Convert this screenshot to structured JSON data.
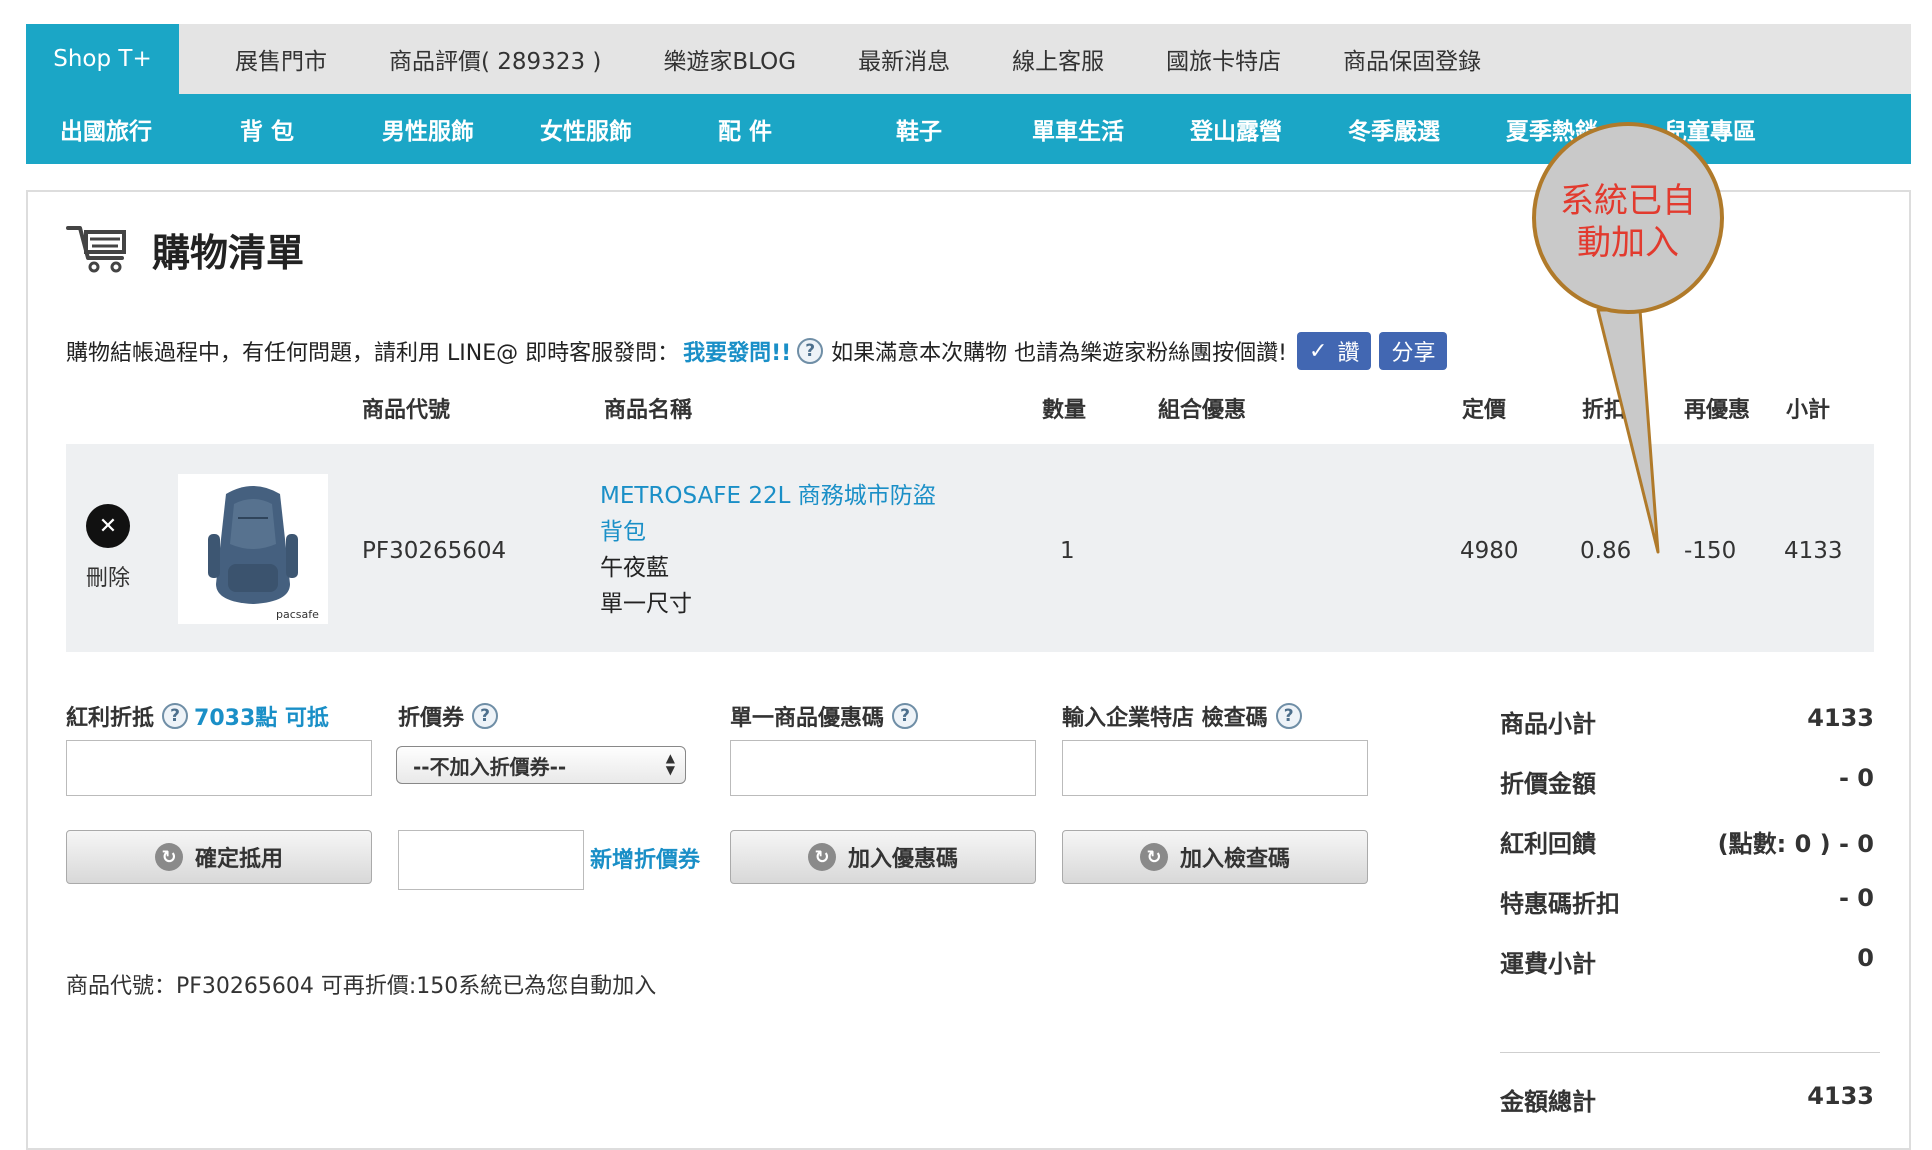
{
  "topnav": {
    "items": [
      "Shop T+",
      "展售門市",
      "商品評價( 289323 )",
      "樂遊家BLOG",
      "最新消息",
      "線上客服",
      "國旅卡特店",
      "商品保固登錄"
    ]
  },
  "subnav": {
    "items": [
      "出國旅行",
      "背 包",
      "男性服飾",
      "女性服飾",
      "配 件",
      "鞋子",
      "單車生活",
      "登山露營",
      "冬季嚴選",
      "夏季熱銷",
      "兒童專區"
    ]
  },
  "page": {
    "title": "購物清單",
    "help_text": "購物結帳過程中，有任何問題，請利用 LINE@ 即時客服發問：",
    "help_link": "我要發問!!",
    "like_text": "如果滿意本次購物 也請為樂遊家粉絲團按個讚!",
    "like_button": "讚",
    "share_button": "分享"
  },
  "table": {
    "headers": [
      "商品代號",
      "商品名稱",
      "數量",
      "組合優惠",
      "定價",
      "折扣",
      "再優惠",
      "小計"
    ],
    "row": {
      "delete_label": "刪除",
      "code": "PF30265604",
      "name_line1": "METROSAFE 22L 商務城市防盜",
      "name_line2": "背包",
      "color": "午夜藍",
      "size": "單一尺寸",
      "qty": "1",
      "combo": "",
      "price": "4980",
      "discount": "0.86",
      "extra": "-150",
      "subtotal": "4133",
      "thumb_brand": "pacsafe"
    }
  },
  "forms": {
    "bonus_label": "紅利折抵",
    "bonus_points": "7033點 可抵",
    "coupon_label": "折價券",
    "coupon_select": "--不加入折價券--",
    "single_code_label": "單一商品優惠碼",
    "enterprise_label": "輸入企業特店 檢查碼",
    "confirm_button": "確定抵用",
    "add_coupon_link": "新增折價券",
    "add_promo_button": "加入優惠碼",
    "add_check_button": "加入檢查碼"
  },
  "note": "商品代號：PF30265604 可再折價:150系統已為您自動加入",
  "summary": {
    "rows": [
      {
        "label": "商品小計",
        "value": "4133"
      },
      {
        "label": "折價金額",
        "value": "- 0"
      },
      {
        "label": "紅利回饋",
        "value": "(點數: 0 ) - 0"
      },
      {
        "label": "特惠碼折扣",
        "value": "- 0"
      },
      {
        "label": "運費小計",
        "value": "0"
      }
    ],
    "total_label": "金額總計",
    "total_value": "4133"
  },
  "callout": {
    "text_line1": "系統已自",
    "text_line2": "動加入"
  },
  "colors": {
    "accent": "#1ba6c6",
    "link": "#1a8fc7",
    "callout_border": "#b07a2a",
    "callout_text": "#e23a2e"
  }
}
